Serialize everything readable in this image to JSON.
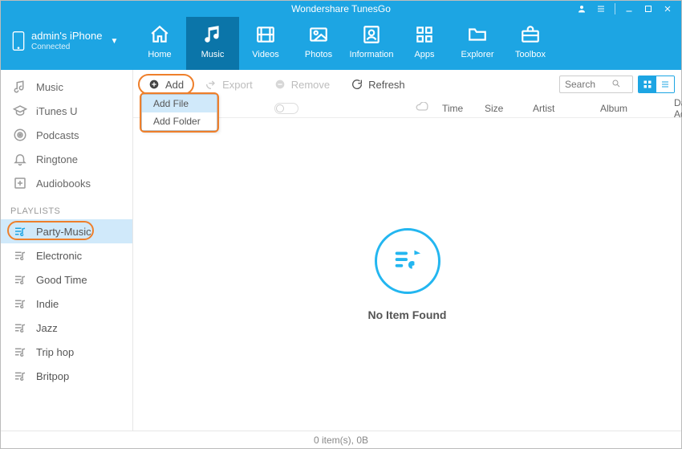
{
  "titlebar": {
    "title": "Wondershare TunesGo"
  },
  "device": {
    "name": "admin's iPhone",
    "status": "Connected"
  },
  "nav": [
    {
      "label": "Home"
    },
    {
      "label": "Music"
    },
    {
      "label": "Videos"
    },
    {
      "label": "Photos"
    },
    {
      "label": "Information"
    },
    {
      "label": "Apps"
    },
    {
      "label": "Explorer"
    },
    {
      "label": "Toolbox"
    }
  ],
  "sidebar": {
    "categories": [
      {
        "label": "Music"
      },
      {
        "label": "iTunes U"
      },
      {
        "label": "Podcasts"
      },
      {
        "label": "Ringtone"
      },
      {
        "label": "Audiobooks"
      }
    ],
    "playlists_title": "PLAYLISTS",
    "playlists": [
      {
        "label": "Party-Music"
      },
      {
        "label": "Electronic"
      },
      {
        "label": "Good Time"
      },
      {
        "label": "Indie"
      },
      {
        "label": "Jazz"
      },
      {
        "label": "Trip hop"
      },
      {
        "label": "Britpop"
      }
    ]
  },
  "toolbar": {
    "add": "Add",
    "export": "Export",
    "remove": "Remove",
    "refresh": "Refresh",
    "search_placeholder": "Search",
    "add_menu": {
      "file": "Add File",
      "folder": "Add Folder"
    }
  },
  "columns": {
    "time": "Time",
    "size": "Size",
    "artist": "Artist",
    "album": "Album",
    "date_added": "Date Added"
  },
  "empty": {
    "message": "No Item Found"
  },
  "status": {
    "text": "0 item(s), 0B"
  }
}
